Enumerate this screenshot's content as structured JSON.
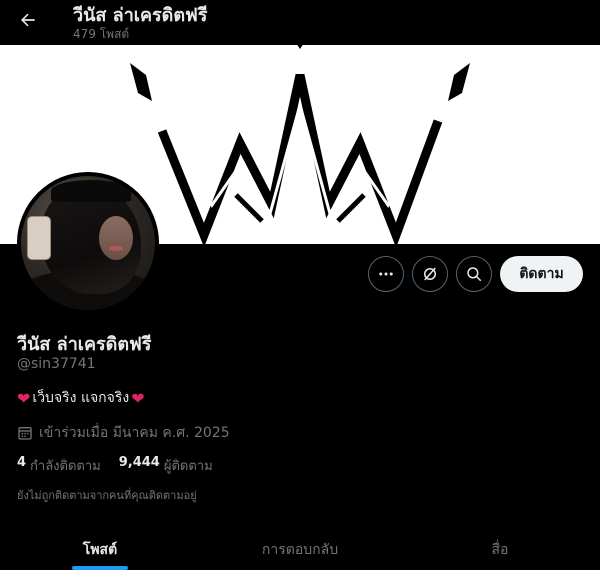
{
  "header": {
    "title": "วีนัส ล่าเครดิตฟรี",
    "post_count": "479 โพสต์"
  },
  "profile": {
    "name": "วีนัส ล่าเครดิตฟรี",
    "handle": "@sin37741",
    "bio": "เว็บจริง แจกจริง",
    "joined": "เข้าร่วมเมื่อ มีนาคม ค.ศ. 2025",
    "following_count": "4",
    "following_label": "กำลังติดตาม",
    "followers_count": "9,444",
    "followers_label": "ผู้ติดตาม",
    "not_followed_note": "ยังไม่ถูกติดตามจากคนที่คุณติดตามอยู่"
  },
  "actions": {
    "follow_label": "ติดตาม",
    "more_icon": "more-dots-icon",
    "grok_icon": "grok-icon",
    "search_icon": "search-icon"
  },
  "tabs": [
    {
      "label": "โพสต์",
      "active": true
    },
    {
      "label": "การตอบกลับ",
      "active": false
    },
    {
      "label": "สื่อ",
      "active": false
    }
  ],
  "colors": {
    "background": "#000000",
    "text_primary": "#e7e9ea",
    "text_secondary": "#71767b",
    "accent": "#1d9bf0",
    "heart": "#e0245e"
  }
}
